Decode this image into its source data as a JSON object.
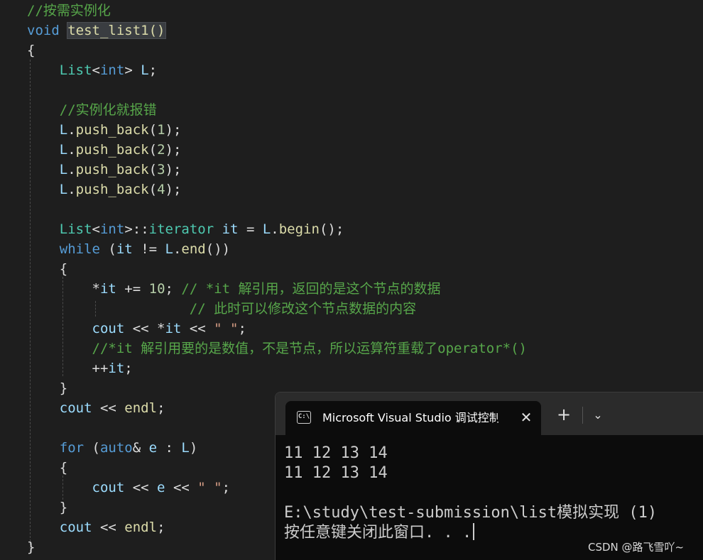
{
  "editor": {
    "lines": [
      [
        {
          "t": "//按需实例化",
          "k": "comment"
        }
      ],
      [
        {
          "t": "void",
          "k": "keyword"
        },
        {
          "t": " ",
          "k": "plain"
        },
        {
          "t": "test_list1()",
          "k": "hl"
        }
      ],
      [
        {
          "t": "{",
          "k": "punc"
        }
      ],
      [
        {
          "t": "    ",
          "k": "plain"
        },
        {
          "t": "List",
          "k": "type"
        },
        {
          "t": "<",
          "k": "punc"
        },
        {
          "t": "int",
          "k": "keyword"
        },
        {
          "t": "> ",
          "k": "punc"
        },
        {
          "t": "L",
          "k": "var"
        },
        {
          "t": ";",
          "k": "punc"
        }
      ],
      [],
      [
        {
          "t": "    ",
          "k": "plain"
        },
        {
          "t": "//实例化就报错",
          "k": "comment"
        }
      ],
      [
        {
          "t": "    ",
          "k": "plain"
        },
        {
          "t": "L",
          "k": "var"
        },
        {
          "t": ".",
          "k": "punc"
        },
        {
          "t": "push_back",
          "k": "func"
        },
        {
          "t": "(",
          "k": "punc"
        },
        {
          "t": "1",
          "k": "num"
        },
        {
          "t": ");",
          "k": "punc"
        }
      ],
      [
        {
          "t": "    ",
          "k": "plain"
        },
        {
          "t": "L",
          "k": "var"
        },
        {
          "t": ".",
          "k": "punc"
        },
        {
          "t": "push_back",
          "k": "func"
        },
        {
          "t": "(",
          "k": "punc"
        },
        {
          "t": "2",
          "k": "num"
        },
        {
          "t": ");",
          "k": "punc"
        }
      ],
      [
        {
          "t": "    ",
          "k": "plain"
        },
        {
          "t": "L",
          "k": "var"
        },
        {
          "t": ".",
          "k": "punc"
        },
        {
          "t": "push_back",
          "k": "func"
        },
        {
          "t": "(",
          "k": "punc"
        },
        {
          "t": "3",
          "k": "num"
        },
        {
          "t": ");",
          "k": "punc"
        }
      ],
      [
        {
          "t": "    ",
          "k": "plain"
        },
        {
          "t": "L",
          "k": "var"
        },
        {
          "t": ".",
          "k": "punc"
        },
        {
          "t": "push_back",
          "k": "func"
        },
        {
          "t": "(",
          "k": "punc"
        },
        {
          "t": "4",
          "k": "num"
        },
        {
          "t": ");",
          "k": "punc"
        }
      ],
      [],
      [
        {
          "t": "    ",
          "k": "plain"
        },
        {
          "t": "List",
          "k": "type"
        },
        {
          "t": "<",
          "k": "punc"
        },
        {
          "t": "int",
          "k": "keyword"
        },
        {
          "t": ">::",
          "k": "punc"
        },
        {
          "t": "iterator",
          "k": "type"
        },
        {
          "t": " ",
          "k": "plain"
        },
        {
          "t": "it",
          "k": "var"
        },
        {
          "t": " = ",
          "k": "punc"
        },
        {
          "t": "L",
          "k": "var"
        },
        {
          "t": ".",
          "k": "punc"
        },
        {
          "t": "begin",
          "k": "func"
        },
        {
          "t": "();",
          "k": "punc"
        }
      ],
      [
        {
          "t": "    ",
          "k": "plain"
        },
        {
          "t": "while",
          "k": "keyword"
        },
        {
          "t": " (",
          "k": "punc"
        },
        {
          "t": "it",
          "k": "var"
        },
        {
          "t": " != ",
          "k": "punc"
        },
        {
          "t": "L",
          "k": "var"
        },
        {
          "t": ".",
          "k": "punc"
        },
        {
          "t": "end",
          "k": "func"
        },
        {
          "t": "())",
          "k": "punc"
        }
      ],
      [
        {
          "t": "    {",
          "k": "punc"
        }
      ],
      [
        {
          "t": "        ",
          "k": "plain"
        },
        {
          "t": "*",
          "k": "punc"
        },
        {
          "t": "it",
          "k": "var"
        },
        {
          "t": " += ",
          "k": "punc"
        },
        {
          "t": "10",
          "k": "num"
        },
        {
          "t": "; ",
          "k": "punc"
        },
        {
          "t": "// *it 解引用，返回的是这个节点的数据",
          "k": "comment"
        }
      ],
      [
        {
          "t": "                    ",
          "k": "plain"
        },
        {
          "t": "// 此时可以修改这个节点数据的内容",
          "k": "comment"
        }
      ],
      [
        {
          "t": "        ",
          "k": "plain"
        },
        {
          "t": "cout",
          "k": "var"
        },
        {
          "t": " << *",
          "k": "punc"
        },
        {
          "t": "it",
          "k": "var"
        },
        {
          "t": " << ",
          "k": "punc"
        },
        {
          "t": "\" \"",
          "k": "str"
        },
        {
          "t": ";",
          "k": "punc"
        }
      ],
      [
        {
          "t": "        ",
          "k": "plain"
        },
        {
          "t": "//*it 解引用要的是数值，不是节点，所以运算符重载了operator*()",
          "k": "comment"
        }
      ],
      [
        {
          "t": "        ",
          "k": "plain"
        },
        {
          "t": "++",
          "k": "punc"
        },
        {
          "t": "it",
          "k": "var"
        },
        {
          "t": ";",
          "k": "punc"
        }
      ],
      [
        {
          "t": "    }",
          "k": "punc"
        }
      ],
      [
        {
          "t": "    ",
          "k": "plain"
        },
        {
          "t": "cout",
          "k": "var"
        },
        {
          "t": " << ",
          "k": "punc"
        },
        {
          "t": "endl",
          "k": "func"
        },
        {
          "t": ";",
          "k": "punc"
        }
      ],
      [],
      [
        {
          "t": "    ",
          "k": "plain"
        },
        {
          "t": "for",
          "k": "keyword"
        },
        {
          "t": " (",
          "k": "punc"
        },
        {
          "t": "auto",
          "k": "keyword"
        },
        {
          "t": "& ",
          "k": "punc"
        },
        {
          "t": "e",
          "k": "var"
        },
        {
          "t": " : ",
          "k": "punc"
        },
        {
          "t": "L",
          "k": "var"
        },
        {
          "t": ")",
          "k": "punc"
        }
      ],
      [
        {
          "t": "    {",
          "k": "punc"
        }
      ],
      [
        {
          "t": "        ",
          "k": "plain"
        },
        {
          "t": "cout",
          "k": "var"
        },
        {
          "t": " << ",
          "k": "punc"
        },
        {
          "t": "e",
          "k": "var"
        },
        {
          "t": " << ",
          "k": "punc"
        },
        {
          "t": "\" \"",
          "k": "str"
        },
        {
          "t": ";",
          "k": "punc"
        }
      ],
      [
        {
          "t": "    }",
          "k": "punc"
        }
      ],
      [
        {
          "t": "    ",
          "k": "plain"
        },
        {
          "t": "cout",
          "k": "var"
        },
        {
          "t": " << ",
          "k": "punc"
        },
        {
          "t": "endl",
          "k": "func"
        },
        {
          "t": ";",
          "k": "punc"
        }
      ],
      [
        {
          "t": "}",
          "k": "punc"
        }
      ]
    ]
  },
  "terminal": {
    "tab_icon_text": "C:\\",
    "tab_title": "Microsoft Visual Studio 调试控制台",
    "close_glyph": "✕",
    "new_tab_glyph": "+",
    "dropdown_glyph": "⌄",
    "output_lines": [
      "11 12 13 14",
      "11 12 13 14",
      "",
      "E:\\study\\test-submission\\list模拟实现 (1) ",
      "按任意键关闭此窗口. . ."
    ]
  },
  "watermark": "CSDN @路飞雪吖~",
  "colors": {
    "background": "#1e1e1e",
    "comment": "#57a64a",
    "keyword": "#569cd6",
    "type": "#4ec9b0",
    "function": "#dcdcaa",
    "variable": "#9cdcfe",
    "number": "#b5cea8",
    "string": "#d69d85",
    "terminal_bg": "#0c0c0c"
  }
}
